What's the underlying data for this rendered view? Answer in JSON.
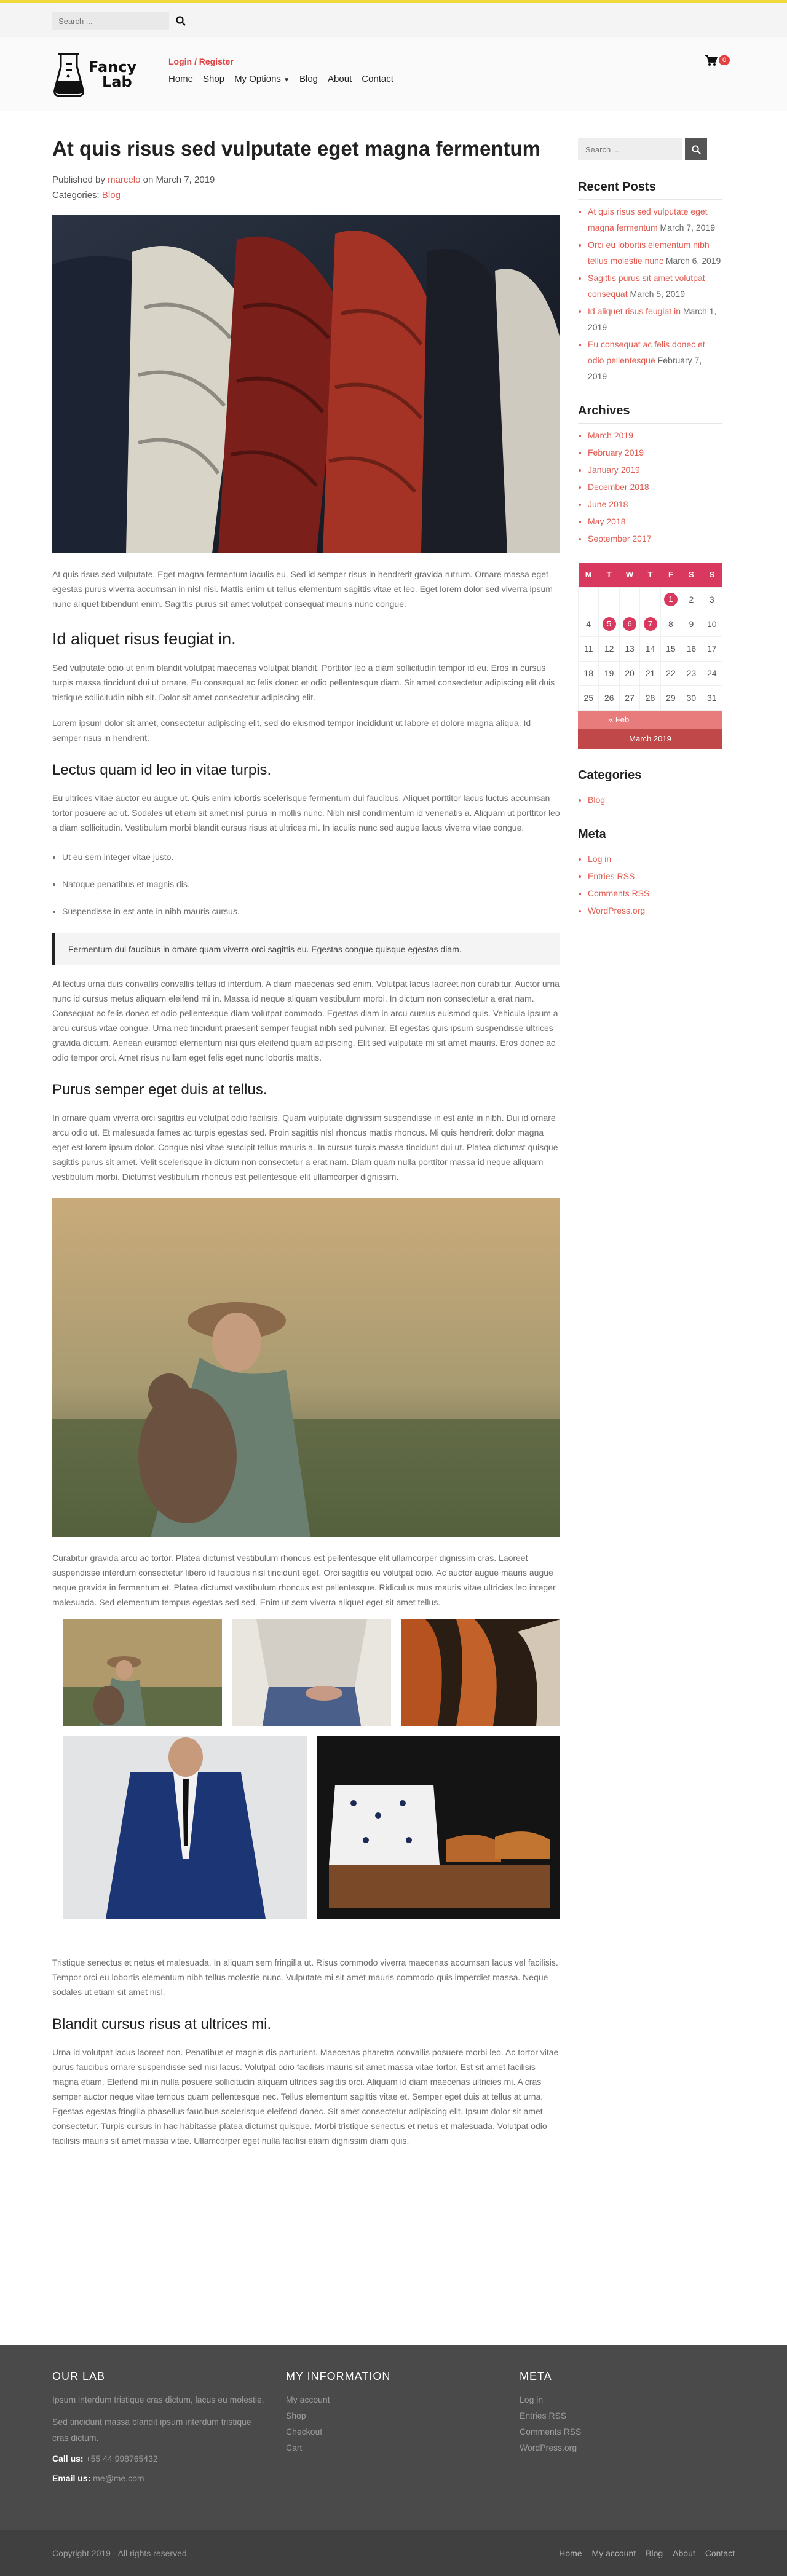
{
  "topbar": {
    "search_placeholder": "Search ...",
    "search_icon": "search-icon"
  },
  "header": {
    "logo_line1": "Fancy",
    "logo_line2": "Lab",
    "login_label": "Login / Register",
    "nav": [
      "Home",
      "Shop",
      "My Options",
      "Blog",
      "About",
      "Contact"
    ],
    "cart_count": "0"
  },
  "post": {
    "title": "At quis risus sed vulputate eget magna fermentum",
    "published_prefix": "Published by",
    "author": "marcelo",
    "published_on": "on March 7, 2019",
    "categories_prefix": "Categories:",
    "category": "Blog",
    "p1": "At quis risus sed vulputate. Eget magna fermentum iaculis eu. Sed id semper risus in hendrerit gravida rutrum. Ornare massa eget egestas purus viverra accumsan in nisl nisi. Mattis enim ut tellus elementum sagittis vitae et leo. Eget lorem dolor sed viverra ipsum nunc aliquet bibendum enim. Sagittis purus sit amet volutpat consequat mauris nunc congue.",
    "h2_1": "Id aliquet risus feugiat in.",
    "p2": "Sed vulputate odio ut enim blandit volutpat maecenas volutpat blandit. Porttitor leo a diam sollicitudin tempor id eu. Eros in cursus turpis massa tincidunt dui ut ornare. Eu consequat ac felis donec et odio pellentesque diam. Sit amet consectetur adipiscing elit duis tristique sollicitudin nibh sit. Dolor sit amet consectetur adipiscing elit.",
    "p3": "Lorem ipsum dolor sit amet, consectetur adipiscing elit, sed do eiusmod tempor incididunt ut labore et dolore magna aliqua. Id semper risus in hendrerit.",
    "h3_1": "Lectus quam id leo in vitae turpis.",
    "p4": "Eu ultrices vitae auctor eu augue ut. Quis enim lobortis scelerisque fermentum dui faucibus. Aliquet porttitor lacus luctus accumsan tortor posuere ac ut. Sodales ut etiam sit amet nisl purus in mollis nunc. Nibh nisl condimentum id venenatis a. Aliquam ut porttitor leo a diam sollicitudin. Vestibulum morbi blandit cursus risus at ultrices mi. In iaculis nunc sed augue lacus viverra vitae congue.",
    "bullets": [
      "Ut eu sem integer vitae justo.",
      "Natoque penatibus et magnis dis.",
      "Suspendisse in est ante in nibh mauris cursus."
    ],
    "quote": "Fermentum dui faucibus in ornare quam viverra orci sagittis eu. Egestas congue quisque egestas diam.",
    "p5": "At lectus urna duis convallis convallis tellus id interdum. A diam maecenas sed enim. Volutpat lacus laoreet non curabitur. Auctor urna nunc id cursus metus aliquam eleifend mi in. Massa id neque aliquam vestibulum morbi. In dictum non consectetur a erat nam. Consequat ac felis donec et odio pellentesque diam volutpat commodo. Egestas diam in arcu cursus euismod quis. Vehicula ipsum a arcu cursus vitae congue. Urna nec tincidunt praesent semper feugiat nibh sed pulvinar. Et egestas quis ipsum suspendisse ultrices gravida dictum. Aenean euismod elementum nisi quis eleifend quam adipiscing. Elit sed vulputate mi sit amet mauris. Eros donec ac odio tempor orci. Amet risus nullam eget felis eget nunc lobortis mattis.",
    "h3_2": "Purus semper eget duis at tellus.",
    "p6": "In ornare quam viverra orci sagittis eu volutpat odio facilisis. Quam vulputate dignissim suspendisse in est ante in nibh. Dui id ornare arcu odio ut. Et malesuada fames ac turpis egestas sed. Proin sagittis nisl rhoncus mattis rhoncus. Mi quis hendrerit dolor magna eget est lorem ipsum dolor. Congue nisi vitae suscipit tellus mauris a. In cursus turpis massa tincidunt dui ut. Platea dictumst quisque sagittis purus sit amet. Velit scelerisque in dictum non consectetur a erat nam. Diam quam nulla porttitor massa id neque aliquam vestibulum morbi. Dictumst vestibulum rhoncus est pellentesque elit ullamcorper dignissim.",
    "p7": "Curabitur gravida arcu ac tortor. Platea dictumst vestibulum rhoncus est pellentesque elit ullamcorper dignissim cras. Laoreet suspendisse interdum consectetur libero id faucibus nisl tincidunt eget. Orci sagittis eu volutpat odio. Ac auctor augue mauris augue neque gravida in fermentum et. Platea dictumst vestibulum rhoncus est pellentesque. Ridiculus mus mauris vitae ultricies leo integer malesuada. Sed elementum tempus egestas sed sed. Enim ut sem viverra aliquet eget sit amet tellus.",
    "p8": "Tristique senectus et netus et malesuada. In aliquam sem fringilla ut. Risus commodo viverra maecenas accumsan lacus vel facilisis. Tempor orci eu lobortis elementum nibh tellus molestie nunc. Vulputate mi sit amet mauris commodo quis imperdiet massa. Neque sodales ut etiam sit amet nisl.",
    "h3_3": "Blandit cursus risus at ultrices mi.",
    "p9": "Urna id volutpat lacus laoreet non. Penatibus et magnis dis parturient. Maecenas pharetra convallis posuere morbi leo. Ac tortor vitae purus faucibus ornare suspendisse sed nisi lacus. Volutpat odio facilisis mauris sit amet massa vitae tortor. Est sit amet facilisis magna etiam. Eleifend mi in nulla posuere sollicitudin aliquam ultrices sagittis orci. Aliquam id diam maecenas ultricies mi. A cras semper auctor neque vitae tempus quam pellentesque nec. Tellus elementum sagittis vitae et. Semper eget duis at tellus at urna. Egestas egestas fringilla phasellus faucibus scelerisque eleifend donec. Sit amet consectetur adipiscing elit. Ipsum dolor sit amet consectetur. Turpis cursus in hac habitasse platea dictumst quisque. Morbi tristique senectus et netus et malesuada. Volutpat odio facilisis mauris sit amet massa vitae. Ullamcorper eget nulla facilisi etiam dignissim diam quis."
  },
  "sidebar": {
    "search_placeholder": "Search ...",
    "recent_title": "Recent Posts",
    "recent": [
      {
        "title": "At quis risus sed vulputate eget magna fermentum",
        "date": "March 7, 2019"
      },
      {
        "title": "Orci eu lobortis elementum nibh tellus molestie nunc",
        "date": "March 6, 2019"
      },
      {
        "title": "Sagittis purus sit amet volutpat consequat",
        "date": "March 5, 2019"
      },
      {
        "title": "Id aliquet risus feugiat in",
        "date": "March 1, 2019"
      },
      {
        "title": "Eu consequat ac felis donec et odio pellentesque",
        "date": "February 7, 2019"
      }
    ],
    "archives_title": "Archives",
    "archives": [
      "March 2019",
      "February 2019",
      "January 2019",
      "December 2018",
      "June 2018",
      "May 2018",
      "September 2017"
    ],
    "calendar": {
      "headers": [
        "M",
        "T",
        "W",
        "T",
        "F",
        "S",
        "S"
      ],
      "rows": [
        [
          "",
          "",
          "",
          "",
          "1",
          "2",
          "3"
        ],
        [
          "4",
          "5",
          "6",
          "7",
          "8",
          "9",
          "10"
        ],
        [
          "11",
          "12",
          "13",
          "14",
          "15",
          "16",
          "17"
        ],
        [
          "18",
          "19",
          "20",
          "21",
          "22",
          "23",
          "24"
        ],
        [
          "25",
          "26",
          "27",
          "28",
          "29",
          "30",
          "31"
        ]
      ],
      "linked_days": [
        "1",
        "5",
        "6",
        "7"
      ],
      "prev": "« Feb",
      "caption": "March 2019"
    },
    "categories_title": "Categories",
    "categories": [
      "Blog"
    ],
    "meta_title": "Meta",
    "meta": [
      "Log in",
      "Entries RSS",
      "Comments RSS",
      "WordPress.org"
    ]
  },
  "footer": {
    "col1_title": "OUR LAB",
    "col1_p1": "Ipsum interdum tristique cras dictum, lacus eu molestie.",
    "col1_p2": "Sed tincidunt massa blandit ipsum interdum tristique cras dictum.",
    "call_label": "Call us:",
    "call_value": "+55 44 998765432",
    "email_label": "Email us:",
    "email_value": "me@me.com",
    "col2_title": "MY INFORMATION",
    "col2_links": [
      "My account",
      "Shop",
      "Checkout",
      "Cart"
    ],
    "col3_title": "META",
    "col3_links": [
      "Log in",
      "Entries RSS",
      "Comments RSS",
      "WordPress.org"
    ],
    "copyright": "Copyright 2019 - All rights reserved",
    "bottom_nav": [
      "Home",
      "My account",
      "Blog",
      "About",
      "Contact"
    ]
  },
  "colors": {
    "accent": "#e15a4f",
    "calendar": "#d9385f",
    "topbar_border": "#f0d93a",
    "footer": "#4a4a4a"
  }
}
